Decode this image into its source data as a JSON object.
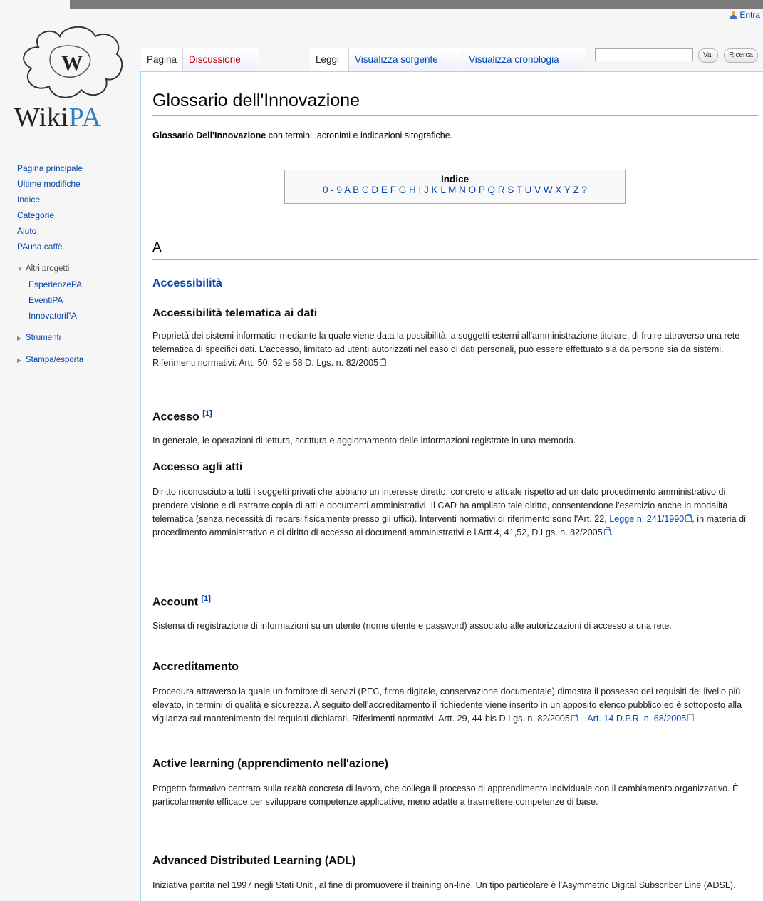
{
  "personal": {
    "login": "Entra"
  },
  "logo": {
    "text_wiki": "Wiki",
    "text_pa": "PA"
  },
  "sidebar": {
    "nav": [
      "Pagina principale",
      "Ultime modifiche",
      "Indice",
      "Categorie",
      "Aiuto",
      "PAusa caffè"
    ],
    "altri_progetti": {
      "label": "Altri progetti",
      "items": [
        "EsperienzePA",
        "EventiPA",
        "InnovatoriPA"
      ]
    },
    "strumenti": "Strumenti",
    "stampa": "Stampa/esporta"
  },
  "tabs": {
    "pagina": "Pagina",
    "discussione": "Discussione",
    "leggi": "Leggi",
    "sorgente": "Visualizza sorgente",
    "cronologia": "Visualizza cronologia"
  },
  "search": {
    "placeholder": "",
    "vai": "Vai",
    "ricerca": "Ricerca"
  },
  "page": {
    "title": "Glossario dell'Innovazione",
    "intro_bold": "Glossario Dell'Innovazione",
    "intro_rest": " con termini, acronimi e indicazioni sitografiche.",
    "toc_title": "Indice",
    "toc_links": [
      "0 - 9",
      "A",
      "B",
      "C",
      "D",
      "E",
      "F",
      "G",
      "H",
      "I",
      "J",
      "K",
      "L",
      "M",
      "N",
      "O",
      "P",
      "Q",
      "R",
      "S",
      "T",
      "U",
      "V",
      "W",
      "X",
      "Y",
      "Z",
      "?"
    ],
    "section": "A"
  },
  "entries": {
    "e1_title": "Accessibilità",
    "e2_title": "Accessibilità telematica ai dati",
    "e2_text": "Proprietà dei sistemi informatici mediante la quale viene data la possibilità, a soggetti esterni all'amministrazione titolare, di fruire attraverso una rete telematica di specifici dati. L'accesso, limitato ad utenti autorizzati nel caso di dati personali, può essere effettuato sia da persone sia da sistemi. Riferimenti normativi: Artt. 50, 52 e 58 D. Lgs. n. 82/2005",
    "e3_title": "Accesso",
    "e3_ref": "[1]",
    "e3_text": "In generale, le operazioni di lettura, scrittura e aggiornamento delle informazioni registrate in una memoria.",
    "e4_title": "Accesso agli atti",
    "e4_text_a": "Diritto riconosciuto a tutti i soggetti privati che abbiano un interesse diretto, concreto e attuale rispetto ad un dato procedimento amministrativo di prendere visione e di estrarre copia di atti e documenti amministrativi. Il CAD ha ampliato tale diritto, consentendone l'esercizio anche in modalità telematica (senza necessità di recarsi fisicamente presso gli uffici). Interventi normativi di riferimento sono l'Art. 22, ",
    "e4_link": "Legge n. 241/1990",
    "e4_text_b": ", in materia di procedimento amministrativo e di diritto di accesso ai documenti amministrativi e l'Artt.4, 41,52, D.Lgs. n. 82/2005",
    "e5_title": "Account",
    "e5_ref": "[1]",
    "e5_text": "Sistema di registrazione di informazioni su un utente (nome utente e password) associato alle autorizzazioni di accesso a una rete.",
    "e6_title": "Accreditamento",
    "e6_text": "Procedura attraverso la quale un fornitore di servizi (PEC, firma digitale, conservazione documentale) dimostra il possesso dei requisiti del livello più elevato, in termini di qualità e sicurezza. A seguito dell'accreditamento il richiedente viene inserito in un apposito elenco pubblico ed è sottoposto alla vigilanza sul mantenimento dei requisiti dichiarati. Riferimenti normativi: Artt. 29, 44-bis D.Lgs. n. 82/2005",
    "e6_sep": " – ",
    "e6_link": "Art. 14 D.P.R. n. 68/2005",
    "e7_title": "Active learning (apprendimento nell'azione)",
    "e7_text": "Progetto formativo centrato sulla realtà concreta di lavoro, che collega il processo di apprendimento individuale con il cambiamento organizzativo. È particolarmente efficace per sviluppare competenze applicative, meno adatte a trasmettere competenze di base.",
    "e8_title": "Advanced Distributed Learning (ADL)",
    "e8_text": "Iniziativa partita nel 1997 negli Stati Uniti, al fine di promuovere il training on-line. Un tipo particolare è l'Asymmetric Digital Subscriber Line (ADSL)."
  }
}
